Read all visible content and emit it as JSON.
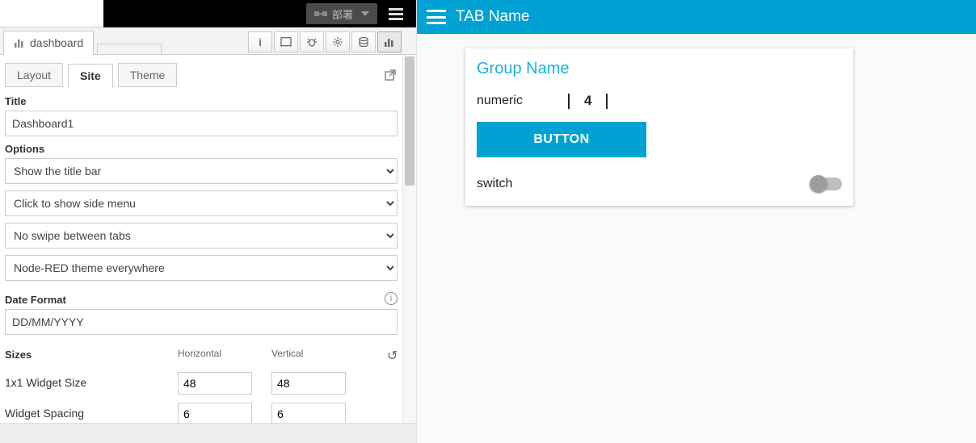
{
  "editor": {
    "deploy_label": "部署",
    "sidebar_tab": "dashboard",
    "tabs": {
      "layout": "Layout",
      "site": "Site",
      "theme": "Theme"
    },
    "title_label": "Title",
    "title_value": "Dashboard1",
    "options_label": "Options",
    "opt_titlebar": "Show the title bar",
    "opt_sidemenu": "Click to show side menu",
    "opt_swipe": "No swipe between tabs",
    "opt_theme": "Node-RED theme everywhere",
    "dateformat_label": "Date Format",
    "dateformat_value": "DD/MM/YYYY",
    "sizes_label": "Sizes",
    "horiz_label": "Horizontal",
    "vert_label": "Vertical",
    "row_widget": "1x1 Widget Size",
    "row_spacing": "Widget Spacing",
    "h_widget": "48",
    "v_widget": "48",
    "h_spacing": "6",
    "v_spacing": "6"
  },
  "dashboard": {
    "tab_title": "TAB Name",
    "group_title": "Group Name",
    "numeric_label": "numeric",
    "numeric_value": "4",
    "button_label": "BUTTON",
    "switch_label": "switch"
  }
}
